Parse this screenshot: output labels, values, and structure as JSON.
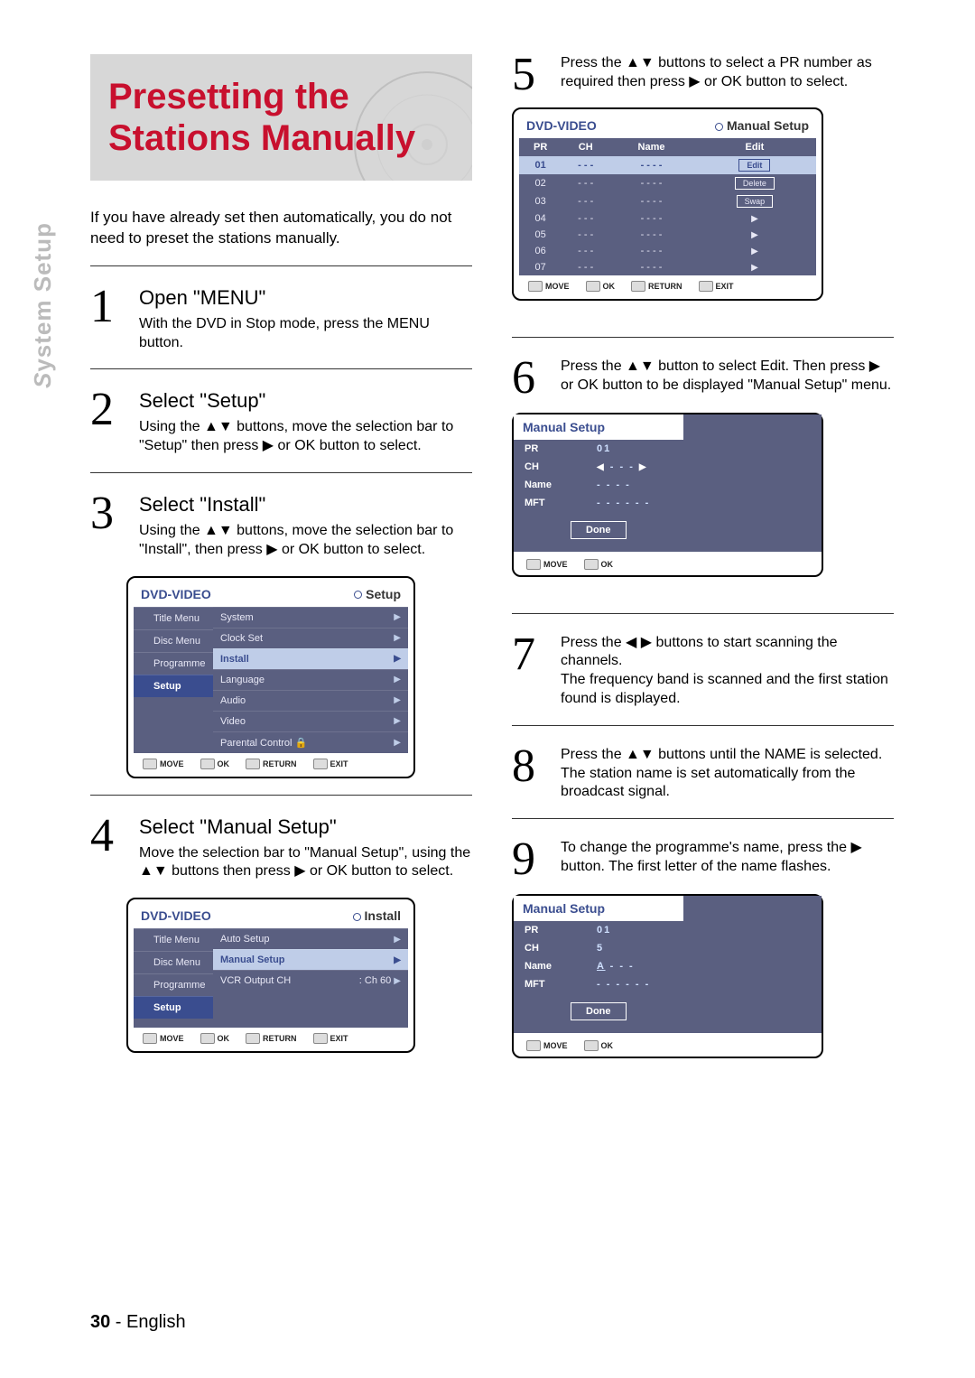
{
  "side_tab": "System Setup",
  "title": "Presetting the Stations Manually",
  "intro": "If you have already set then automatically, you do not need to preset the stations manually.",
  "steps": {
    "s1": {
      "num": "1",
      "heading": "Open \"MENU\"",
      "text": "With the DVD in Stop mode, press the MENU button."
    },
    "s2": {
      "num": "2",
      "heading": "Select \"Setup\"",
      "text": "Using the ▲▼ buttons, move the selection bar to \"Setup\" then press ▶ or OK button to select."
    },
    "s3": {
      "num": "3",
      "heading": "Select \"Install\"",
      "text": "Using the ▲▼ buttons, move the selection bar to \"Install\", then press ▶ or OK button to select."
    },
    "s4": {
      "num": "4",
      "heading": "Select \"Manual Setup\"",
      "text": "Move the selection bar to \"Manual Setup\", using the ▲▼ buttons then press ▶ or OK button to select."
    },
    "s5": {
      "num": "5",
      "text": "Press the ▲▼ buttons to select a PR number as required then press ▶ or OK button to select."
    },
    "s6": {
      "num": "6",
      "text": "Press the ▲▼ button to select Edit. Then press ▶ or OK button to be displayed \"Manual Setup\" menu."
    },
    "s7": {
      "num": "7",
      "text": "Press the ◀ ▶ buttons to start scanning the channels.",
      "text2": "The frequency band is scanned and the first station found is displayed."
    },
    "s8": {
      "num": "8",
      "text": "Press the ▲▼ buttons until the NAME is selected. The station name is set automatically from the broadcast signal."
    },
    "s9": {
      "num": "9",
      "text": "To change the programme's name, press the ▶ button. The first letter of the name flashes."
    }
  },
  "osd_setup": {
    "title_left": "DVD-VIDEO",
    "title_right": "Setup",
    "menu": [
      "Title Menu",
      "Disc Menu",
      "Programme",
      "Setup"
    ],
    "selected_menu": 3,
    "items": [
      "System",
      "Clock Set",
      "Install",
      "Language",
      "Audio",
      "Video",
      "Parental Control"
    ],
    "selected_item": 2,
    "footer": [
      "MOVE",
      "OK",
      "RETURN",
      "EXIT"
    ]
  },
  "osd_install": {
    "title_left": "DVD-VIDEO",
    "title_right": "Install",
    "menu": [
      "Title Menu",
      "Disc Menu",
      "Programme",
      "Setup"
    ],
    "selected_menu": 3,
    "items": [
      {
        "label": "Auto Setup",
        "value": ""
      },
      {
        "label": "Manual Setup",
        "value": ""
      },
      {
        "label": "VCR Output CH",
        "value": ": Ch 60"
      }
    ],
    "selected_item": 1,
    "footer": [
      "MOVE",
      "OK",
      "RETURN",
      "EXIT"
    ]
  },
  "osd_prtable": {
    "title_left": "DVD-VIDEO",
    "title_right": "Manual Setup",
    "cols": [
      "PR",
      "CH",
      "Name",
      "Edit"
    ],
    "rows": [
      {
        "pr": "01",
        "ch": "- - -",
        "name": "- - - -",
        "edit": "Edit",
        "sel": true
      },
      {
        "pr": "02",
        "ch": "- - -",
        "name": "- - - -",
        "edit": "Delete"
      },
      {
        "pr": "03",
        "ch": "- - -",
        "name": "- - - -",
        "edit": "Swap"
      },
      {
        "pr": "04",
        "ch": "- - -",
        "name": "- - - -",
        "edit": "▶"
      },
      {
        "pr": "05",
        "ch": "- - -",
        "name": "- - - -",
        "edit": "▶"
      },
      {
        "pr": "06",
        "ch": "- - -",
        "name": "- - - -",
        "edit": "▶"
      },
      {
        "pr": "07",
        "ch": "- - -",
        "name": "- - - -",
        "edit": "▶"
      }
    ],
    "footer": [
      "MOVE",
      "OK",
      "RETURN",
      "EXIT"
    ]
  },
  "osd_ms1": {
    "title": "Manual Setup",
    "rows": [
      {
        "k": "PR",
        "v": "01"
      },
      {
        "k": "CH",
        "v": "- - -",
        "arrows": true
      },
      {
        "k": "Name",
        "v": "- - - -"
      },
      {
        "k": "MFT",
        "v": "- - -   - - -"
      }
    ],
    "done": "Done",
    "footer": [
      "MOVE",
      "OK"
    ]
  },
  "osd_ms2": {
    "title": "Manual Setup",
    "rows": [
      {
        "k": "PR",
        "v": "01"
      },
      {
        "k": "CH",
        "v": "5"
      },
      {
        "k": "Name",
        "v": "A - - -",
        "underline": true
      },
      {
        "k": "MFT",
        "v": "- - -   - - -"
      }
    ],
    "done": "Done",
    "footer": [
      "MOVE",
      "OK"
    ]
  },
  "page_footer": {
    "num": "30",
    "dash": " - ",
    "lang": "English"
  }
}
